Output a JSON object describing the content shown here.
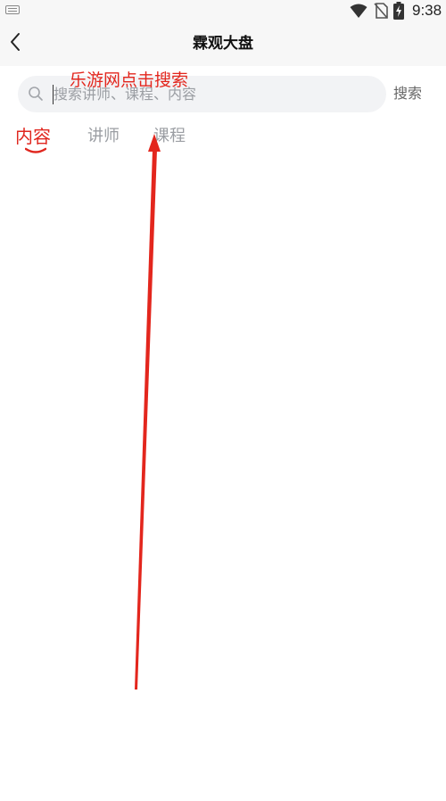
{
  "status_bar": {
    "time": "9:38",
    "icons": [
      "keyboard-icon",
      "wifi-icon",
      "no-sim-icon",
      "battery-charging-icon"
    ]
  },
  "header": {
    "back_icon": "chevron-left-icon",
    "title": "霖观大盘"
  },
  "search": {
    "icon": "search-icon",
    "placeholder": "搜索讲师、课程、内容",
    "value": "",
    "button_label": "搜索"
  },
  "tabs": [
    {
      "label": "内容",
      "active": true
    },
    {
      "label": "讲师",
      "active": false
    },
    {
      "label": "课程",
      "active": false
    }
  ],
  "annotation": {
    "text": "乐游网点击搜索",
    "color": "#e3261d"
  },
  "colors": {
    "accent": "#e0271f",
    "inactive_tab": "#9b9ea3",
    "search_bg": "#f2f3f5",
    "header_bg": "#f7f7f7"
  }
}
